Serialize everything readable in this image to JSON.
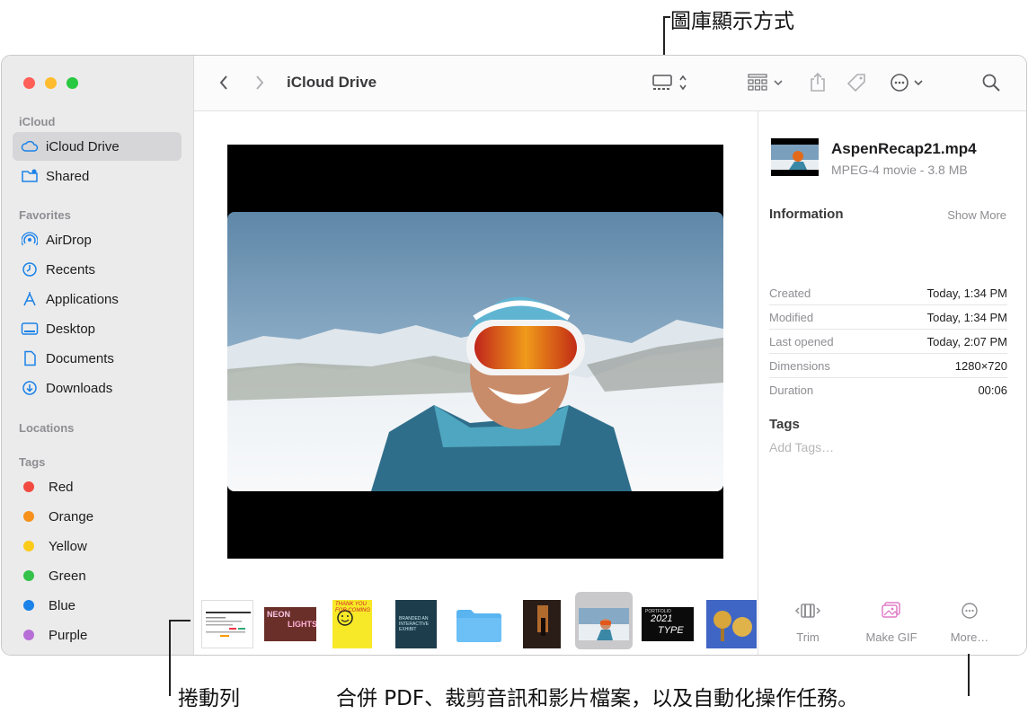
{
  "callouts": {
    "gallery_view": "圖庫顯示方式",
    "scroll_bar": "捲動列",
    "quick_actions": "合併 PDF、裁剪音訊和影片檔案，以及自動化操作任務。"
  },
  "colors": {
    "close": "#ff5f57",
    "minimize": "#febc2e",
    "zoom": "#28c840",
    "accent": "#1a82e8"
  },
  "sidebar": {
    "sections": {
      "icloud": "iCloud",
      "favorites": "Favorites",
      "locations": "Locations",
      "tags": "Tags"
    },
    "icloud_items": [
      {
        "label": "iCloud Drive",
        "icon": "cloud-icon"
      },
      {
        "label": "Shared",
        "icon": "shared-folder-icon"
      }
    ],
    "favorites": [
      {
        "label": "AirDrop",
        "icon": "airdrop-icon"
      },
      {
        "label": "Recents",
        "icon": "clock-icon"
      },
      {
        "label": "Applications",
        "icon": "applications-icon"
      },
      {
        "label": "Desktop",
        "icon": "desktop-icon"
      },
      {
        "label": "Documents",
        "icon": "document-icon"
      },
      {
        "label": "Downloads",
        "icon": "download-icon"
      }
    ],
    "tags": [
      {
        "label": "Red",
        "color": "#f24a41"
      },
      {
        "label": "Orange",
        "color": "#f6911c"
      },
      {
        "label": "Yellow",
        "color": "#fbcb1a"
      },
      {
        "label": "Green",
        "color": "#35c14a"
      },
      {
        "label": "Blue",
        "color": "#1a82e8"
      },
      {
        "label": "Purple",
        "color": "#b76ed7"
      }
    ]
  },
  "toolbar": {
    "title": "iCloud Drive"
  },
  "inspector": {
    "file_name": "AspenRecap21.mp4",
    "file_kind": "MPEG-4 movie - 3.8 MB",
    "information_label": "Information",
    "show_more": "Show More",
    "rows": [
      {
        "key": "Created",
        "value": "Today, 1:34 PM"
      },
      {
        "key": "Modified",
        "value": "Today, 1:34 PM"
      },
      {
        "key": "Last opened",
        "value": "Today, 2:07 PM"
      },
      {
        "key": "Dimensions",
        "value": "1280×720"
      },
      {
        "key": "Duration",
        "value": "00:06"
      }
    ],
    "tags_label": "Tags",
    "tags_placeholder": "Add Tags…"
  },
  "thumbnails": {
    "neon_line1": "NEON",
    "neon_line2": "LIGHTS",
    "thank_text": "THANK YOU FOR COMING",
    "immersive_text": "BRANDED AN INTERACTIVE EXHIBIT",
    "portfolio_text": "PORTFOLIO",
    "year_text": "2021",
    "type_text": "TYPE"
  },
  "actions": [
    {
      "label": "Trim",
      "icon": "trim-icon"
    },
    {
      "label": "Make GIF",
      "icon": "make-gif-icon"
    },
    {
      "label": "More…",
      "icon": "more-icon"
    }
  ]
}
